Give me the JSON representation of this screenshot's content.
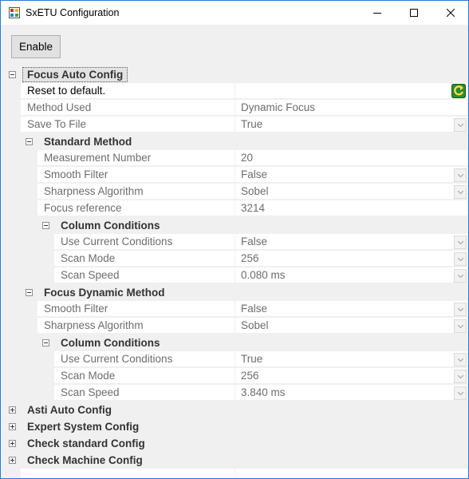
{
  "window": {
    "title": "SxETU Configuration"
  },
  "toolbar": {
    "enable_label": "Enable"
  },
  "grid": {
    "focus_auto": {
      "label": "Focus Auto Config",
      "reset": "Reset to default.",
      "method_used": {
        "name": "Method Used",
        "value": "Dynamic Focus"
      },
      "save_to_file": {
        "name": "Save To File",
        "value": "True"
      },
      "standard": {
        "label": "Standard Method",
        "measurement_number": {
          "name": "Measurement Number",
          "value": "20"
        },
        "smooth_filter": {
          "name": "Smooth Filter",
          "value": "False"
        },
        "sharpness": {
          "name": "Sharpness Algorithm",
          "value": "Sobel"
        },
        "focus_reference": {
          "name": "Focus reference",
          "value": "3214"
        },
        "column": {
          "label": "Column Conditions",
          "use_current": {
            "name": "Use Current Conditions",
            "value": "False"
          },
          "scan_mode": {
            "name": "Scan Mode",
            "value": "256"
          },
          "scan_speed": {
            "name": "Scan Speed",
            "value": "0.080 ms"
          }
        }
      },
      "dynamic": {
        "label": "Focus Dynamic Method",
        "smooth_filter": {
          "name": "Smooth Filter",
          "value": "False"
        },
        "sharpness": {
          "name": "Sharpness Algorithm",
          "value": "Sobel"
        },
        "column": {
          "label": "Column Conditions",
          "use_current": {
            "name": "Use Current Conditions",
            "value": "True"
          },
          "scan_mode": {
            "name": "Scan Mode",
            "value": "256"
          },
          "scan_speed": {
            "name": "Scan Speed",
            "value": "3.840 ms"
          }
        }
      }
    },
    "collapsed": {
      "asti": "Asti Auto Config",
      "expert": "Expert System Config",
      "check_standard": "Check standard Config",
      "check_machine": "Check Machine Config"
    }
  }
}
